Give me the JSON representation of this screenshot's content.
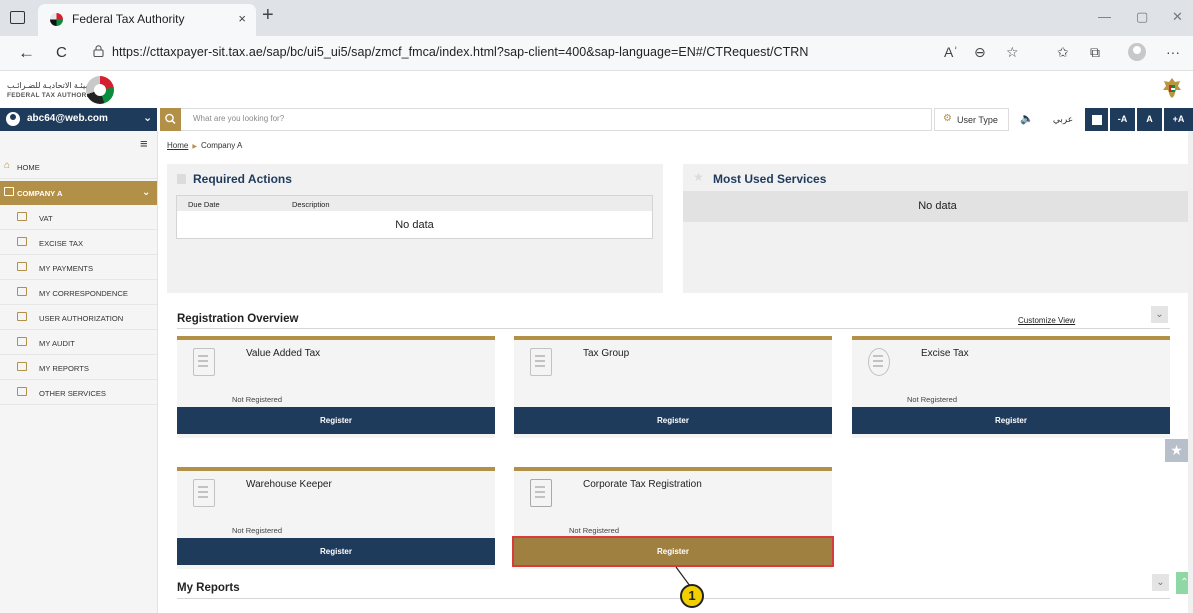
{
  "browser": {
    "tab_title": "Federal Tax Authority",
    "tab_close": "×",
    "new_tab": "+",
    "url": "https://cttaxpayer-sit.tax.ae/sap/bc/ui5_ui5/sap/zmcf_fmca/index.html?sap-client=400&sap-language=EN#/CTRequest/CTRN",
    "back": "←",
    "reload": "C",
    "minimize": "—",
    "restore": "▢",
    "close": "✕",
    "read_aloud": "Aʾ",
    "zoom": "⊖",
    "favorites_add": "☆",
    "favorites": "✩",
    "collections": "⧉",
    "more": "···"
  },
  "header": {
    "logo_ar": "الهيئـة الاتحاديـة للضـرائـب",
    "logo_en": "FEDERAL TAX AUTHORITY"
  },
  "topbar": {
    "user_email": "abc64@web.com",
    "user_chevron": "⌄",
    "search_placeholder": "What are you looking for?",
    "user_type": "User Type",
    "audio": "🔈",
    "arabic": "عربي",
    "font_minus": "-A",
    "font_normal": "A",
    "font_plus": "+A"
  },
  "sidebar": {
    "menu_icon": "≡",
    "home": "HOME",
    "company": "COMPANY A",
    "items": [
      {
        "label": "VAT"
      },
      {
        "label": "EXCISE TAX"
      },
      {
        "label": "MY PAYMENTS"
      },
      {
        "label": "MY CORRESPONDENCE"
      },
      {
        "label": "USER AUTHORIZATION"
      },
      {
        "label": "MY AUDIT"
      },
      {
        "label": "MY REPORTS"
      },
      {
        "label": "OTHER SERVICES"
      }
    ]
  },
  "breadcrumb": {
    "home": "Home",
    "current": "Company A",
    "separator": "▶"
  },
  "required_actions": {
    "title": "Required Actions",
    "columns": [
      "Due Date",
      "Description"
    ],
    "empty": "No data"
  },
  "most_used": {
    "title": "Most Used Services",
    "empty": "No data",
    "star": "★"
  },
  "registration": {
    "title": "Registration Overview",
    "customize": "Customize View",
    "cards": [
      {
        "title": "Value Added Tax",
        "status": "Not Registered",
        "button": "Register"
      },
      {
        "title": "Tax Group",
        "status": "",
        "button": "Register"
      },
      {
        "title": "Excise Tax",
        "status": "Not Registered",
        "button": "Register"
      },
      {
        "title": "Warehouse Keeper",
        "status": "Not Registered",
        "button": "Register"
      },
      {
        "title": "Corporate Tax Registration",
        "status": "Not Registered",
        "button": "Register"
      }
    ]
  },
  "my_reports": {
    "title": "My Reports"
  },
  "callout": {
    "number": "1"
  },
  "misc": {
    "chevron_down": "⌄",
    "favorite_star": "★",
    "scroll_up": "⌃"
  },
  "colors": {
    "navy": "#1f3b5c",
    "gold": "#b39047",
    "highlight": "#d83b3b",
    "callout": "#f2d000"
  }
}
